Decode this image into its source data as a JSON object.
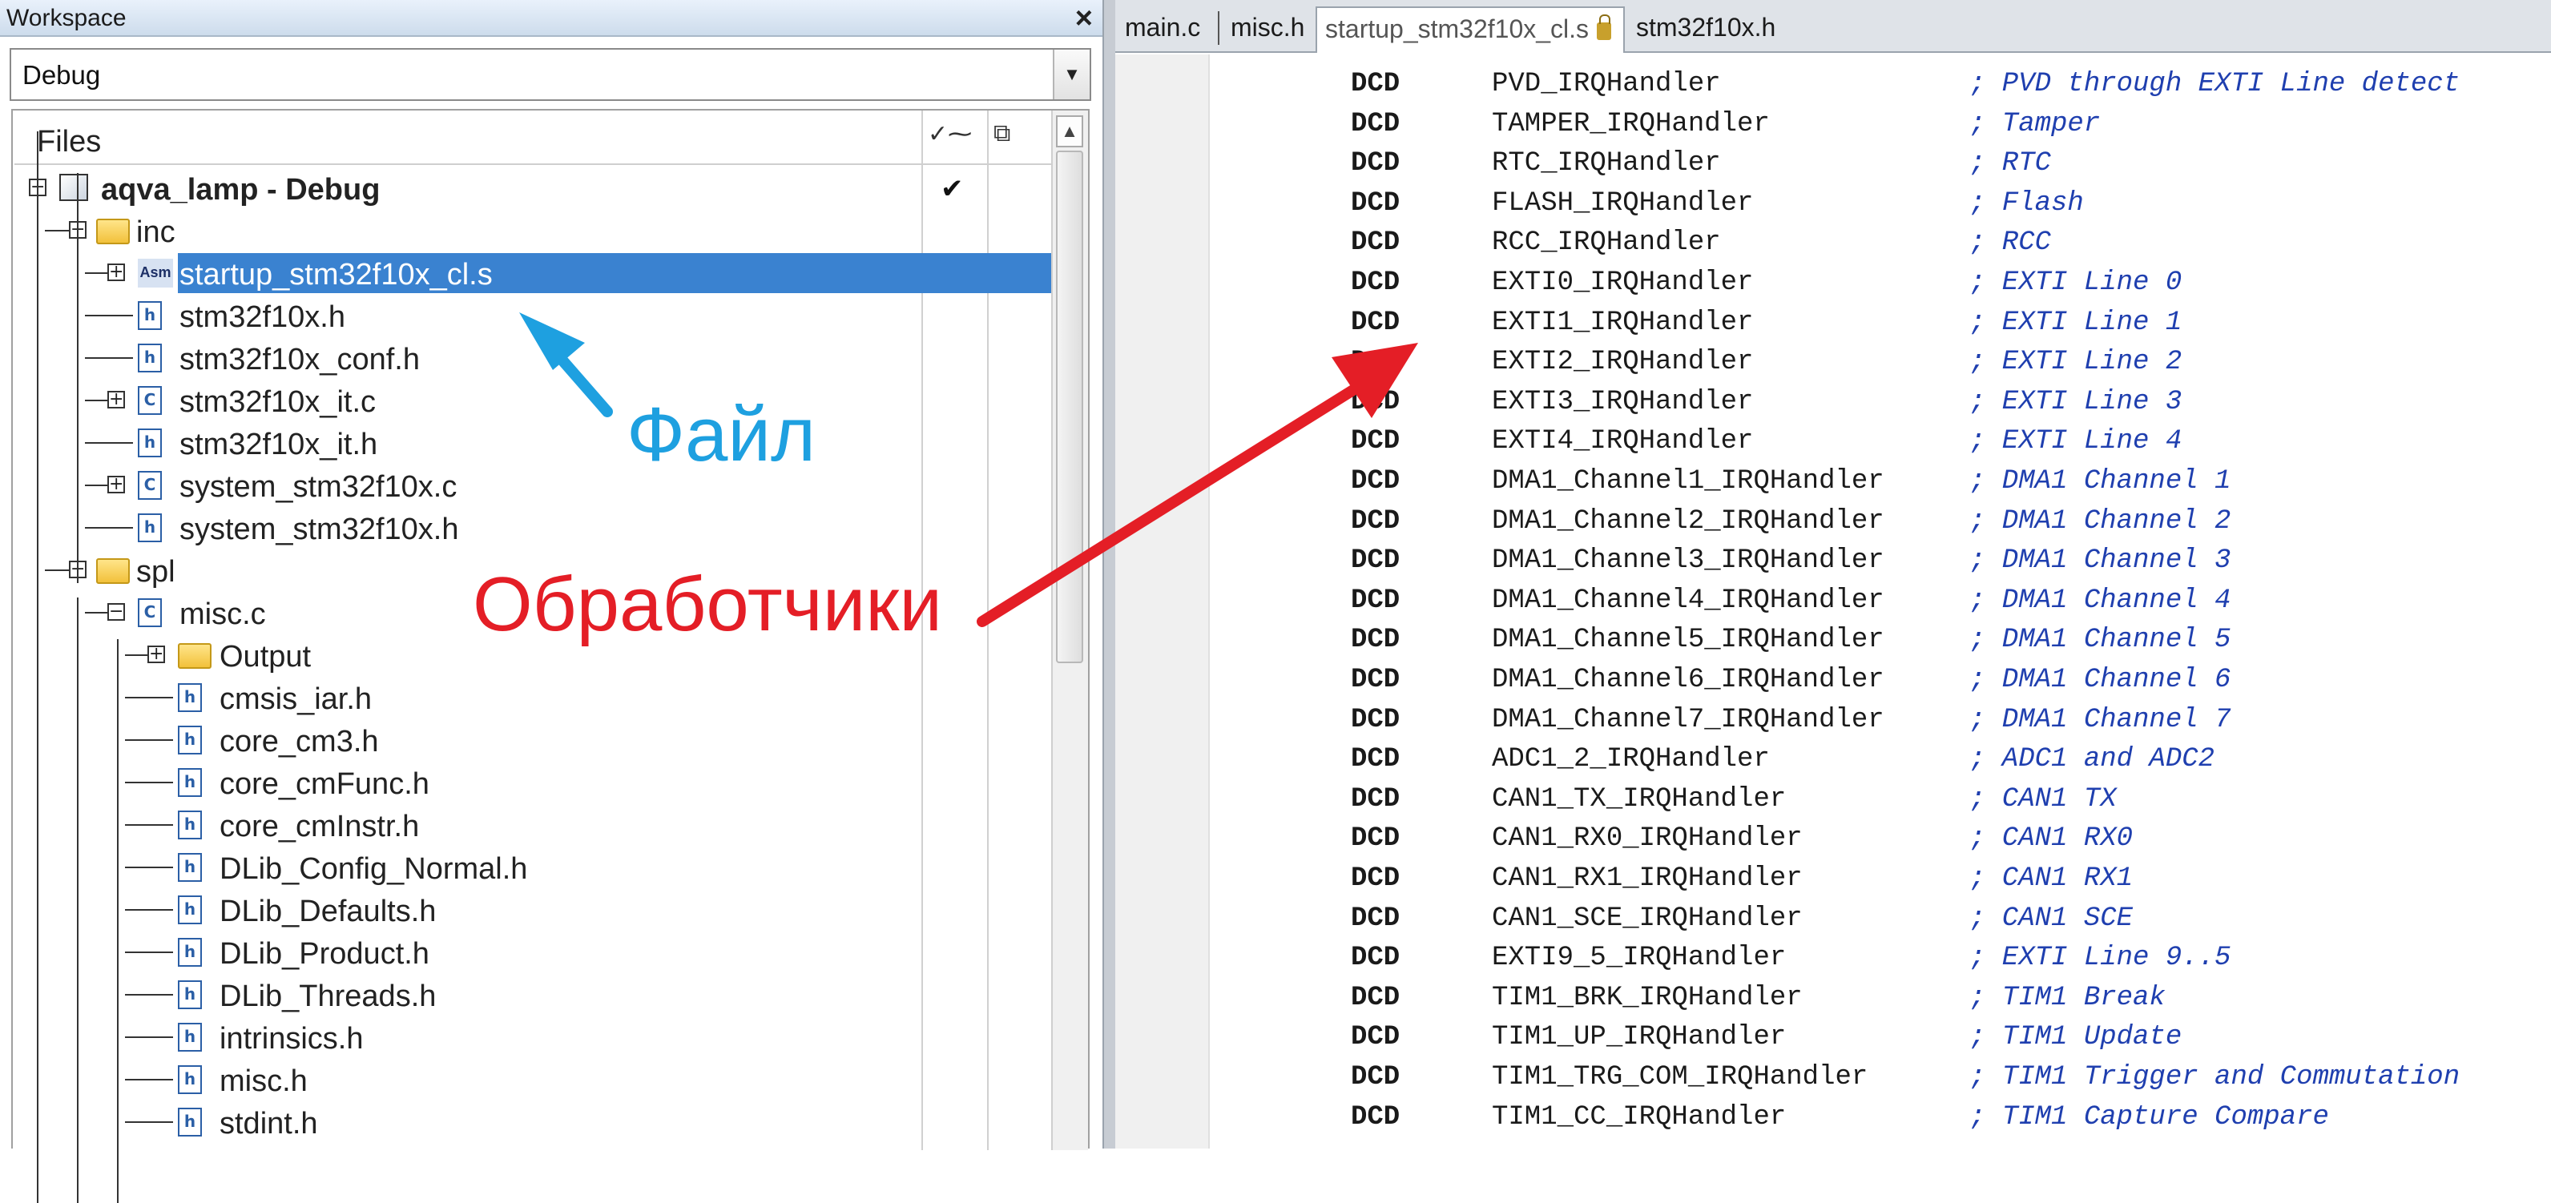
{
  "workspace": {
    "title": "Workspace",
    "close_label": "×",
    "configuration": "Debug"
  },
  "tree": {
    "header": "Files",
    "rows": [
      {
        "label": "aqva_lamp - Debug",
        "icon": "project-icon",
        "toggle": "⊟",
        "check": "✔"
      },
      {
        "label": "inc",
        "icon": "folder-icon",
        "toggle": "⊟"
      },
      {
        "label": "startup_stm32f10x_cl.s",
        "icon": "asm-file-icon",
        "toggle": "⊞",
        "selected": true
      },
      {
        "label": "stm32f10x.h",
        "icon": "header-file-icon"
      },
      {
        "label": "stm32f10x_conf.h",
        "icon": "header-file-icon"
      },
      {
        "label": "stm32f10x_it.c",
        "icon": "c-file-icon",
        "toggle": "⊞"
      },
      {
        "label": "stm32f10x_it.h",
        "icon": "header-file-icon"
      },
      {
        "label": "system_stm32f10x.c",
        "icon": "c-file-icon",
        "toggle": "⊞"
      },
      {
        "label": "system_stm32f10x.h",
        "icon": "header-file-icon"
      },
      {
        "label": "spl",
        "icon": "folder-icon",
        "toggle": "⊟"
      },
      {
        "label": "misc.c",
        "icon": "c-file-icon",
        "toggle": "⊟"
      },
      {
        "label": "Output",
        "icon": "folder-icon",
        "toggle": "⊞"
      },
      {
        "label": "cmsis_iar.h",
        "icon": "header-file-icon"
      },
      {
        "label": "core_cm3.h",
        "icon": "header-file-icon"
      },
      {
        "label": "core_cmFunc.h",
        "icon": "header-file-icon"
      },
      {
        "label": "core_cmInstr.h",
        "icon": "header-file-icon"
      },
      {
        "label": "DLib_Config_Normal.h",
        "icon": "header-file-icon"
      },
      {
        "label": "DLib_Defaults.h",
        "icon": "header-file-icon"
      },
      {
        "label": "DLib_Product.h",
        "icon": "header-file-icon"
      },
      {
        "label": "DLib_Threads.h",
        "icon": "header-file-icon"
      },
      {
        "label": "intrinsics.h",
        "icon": "header-file-icon"
      },
      {
        "label": "misc.h",
        "icon": "header-file-icon"
      },
      {
        "label": "stdint.h",
        "icon": "header-file-icon"
      }
    ]
  },
  "editor": {
    "tabs": [
      {
        "label": "main.c"
      },
      {
        "label": "misc.h"
      },
      {
        "label": "startup_stm32f10x_cl.s",
        "active": true,
        "locked": true
      },
      {
        "label": "stm32f10x.h"
      }
    ],
    "lines": [
      {
        "kw": "DCD",
        "sym": "PVD_IRQHandler",
        "comment": "; PVD through EXTI Line detect"
      },
      {
        "kw": "DCD",
        "sym": "TAMPER_IRQHandler",
        "comment": "; Tamper"
      },
      {
        "kw": "DCD",
        "sym": "RTC_IRQHandler",
        "comment": "; RTC"
      },
      {
        "kw": "DCD",
        "sym": "FLASH_IRQHandler",
        "comment": "; Flash"
      },
      {
        "kw": "DCD",
        "sym": "RCC_IRQHandler",
        "comment": "; RCC"
      },
      {
        "kw": "DCD",
        "sym": "EXTI0_IRQHandler",
        "comment": "; EXTI Line 0"
      },
      {
        "kw": "DCD",
        "sym": "EXTI1_IRQHandler",
        "comment": "; EXTI Line 1"
      },
      {
        "kw": "DCD",
        "sym": "EXTI2_IRQHandler",
        "comment": "; EXTI Line 2"
      },
      {
        "kw": "DCD",
        "sym": "EXTI3_IRQHandler",
        "comment": "; EXTI Line 3"
      },
      {
        "kw": "DCD",
        "sym": "EXTI4_IRQHandler",
        "comment": "; EXTI Line 4"
      },
      {
        "kw": "DCD",
        "sym": "DMA1_Channel1_IRQHandler",
        "comment": "; DMA1 Channel 1"
      },
      {
        "kw": "DCD",
        "sym": "DMA1_Channel2_IRQHandler",
        "comment": "; DMA1 Channel 2"
      },
      {
        "kw": "DCD",
        "sym": "DMA1_Channel3_IRQHandler",
        "comment": "; DMA1 Channel 3"
      },
      {
        "kw": "DCD",
        "sym": "DMA1_Channel4_IRQHandler",
        "comment": "; DMA1 Channel 4"
      },
      {
        "kw": "DCD",
        "sym": "DMA1_Channel5_IRQHandler",
        "comment": "; DMA1 Channel 5"
      },
      {
        "kw": "DCD",
        "sym": "DMA1_Channel6_IRQHandler",
        "comment": "; DMA1 Channel 6"
      },
      {
        "kw": "DCD",
        "sym": "DMA1_Channel7_IRQHandler",
        "comment": "; DMA1 Channel 7"
      },
      {
        "kw": "DCD",
        "sym": "ADC1_2_IRQHandler",
        "comment": "; ADC1 and ADC2"
      },
      {
        "kw": "DCD",
        "sym": "CAN1_TX_IRQHandler",
        "comment": "; CAN1 TX"
      },
      {
        "kw": "DCD",
        "sym": "CAN1_RX0_IRQHandler",
        "comment": "; CAN1 RX0"
      },
      {
        "kw": "DCD",
        "sym": "CAN1_RX1_IRQHandler",
        "comment": "; CAN1 RX1"
      },
      {
        "kw": "DCD",
        "sym": "CAN1_SCE_IRQHandler",
        "comment": "; CAN1 SCE"
      },
      {
        "kw": "DCD",
        "sym": "EXTI9_5_IRQHandler",
        "comment": "; EXTI Line 9..5"
      },
      {
        "kw": "DCD",
        "sym": "TIM1_BRK_IRQHandler",
        "comment": "; TIM1 Break"
      },
      {
        "kw": "DCD",
        "sym": "TIM1_UP_IRQHandler",
        "comment": "; TIM1 Update"
      },
      {
        "kw": "DCD",
        "sym": "TIM1_TRG_COM_IRQHandler",
        "comment": "; TIM1 Trigger and Commutation"
      },
      {
        "kw": "DCD",
        "sym": "TIM1_CC_IRQHandler",
        "comment": "; TIM1 Capture Compare"
      }
    ]
  },
  "annotations": {
    "file_label": "Файл",
    "file_color": "#1ea0e0",
    "handlers_label": "Обработчики",
    "handlers_color": "#e41e26"
  },
  "colors": {
    "selection": "#3a82d0",
    "comment": "#1f3faf"
  }
}
